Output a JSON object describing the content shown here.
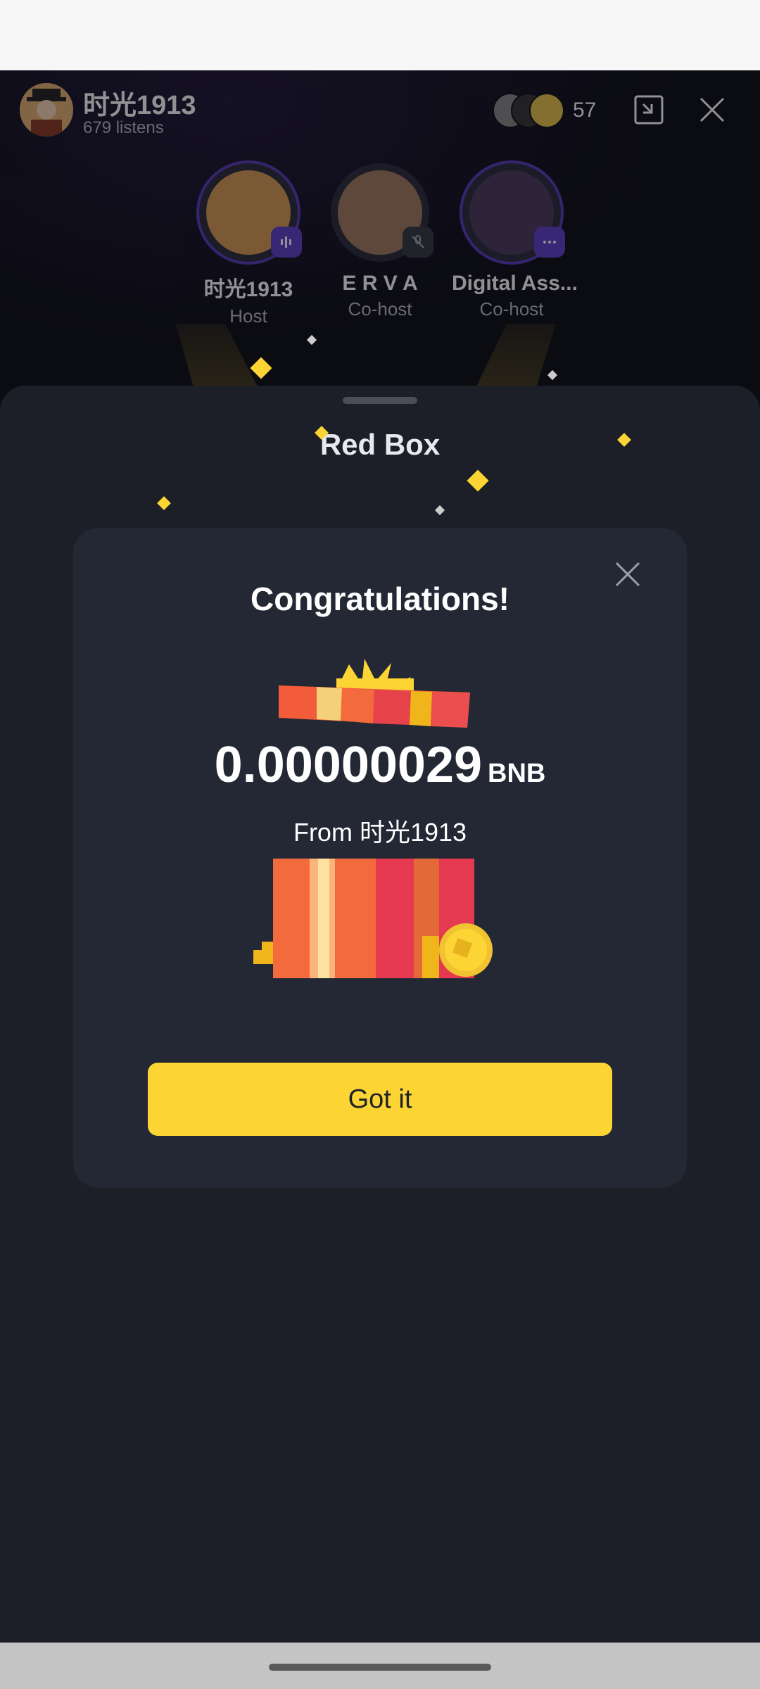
{
  "room": {
    "host_name": "时光1913",
    "listens": "679 listens",
    "listener_count": "57",
    "speakers": [
      {
        "name": "时光1913",
        "role": "Host"
      },
      {
        "name": "E R V A",
        "role": "Co-host"
      },
      {
        "name": "Digital Ass...",
        "role": "Co-host"
      }
    ]
  },
  "sheet": {
    "title": "Red Box"
  },
  "dialog": {
    "title": "Congratulations!",
    "amount": "0.00000029",
    "unit": "BNB",
    "from": "From 时光1913",
    "button_label": "Got it"
  },
  "colors": {
    "accent": "#fcd535",
    "sheet_bg": "#1c1f27",
    "dialog_bg": "#232834",
    "speaker_badge": "#5b3fc4"
  },
  "icons": {
    "minimize": "minimize-icon",
    "close": "close-icon",
    "gift": "gift-box-icon",
    "coin": "coin-icon"
  }
}
